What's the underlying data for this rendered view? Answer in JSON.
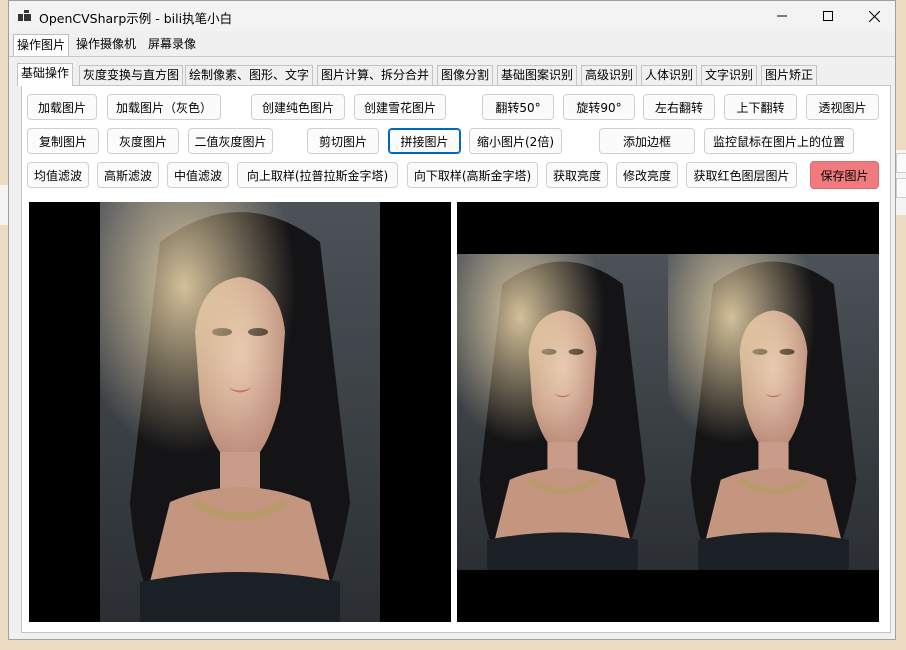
{
  "window": {
    "title": "OpenCVSharp示例 - bili执笔小白"
  },
  "menu": [
    "操作图片",
    "操作摄像机",
    "屏幕录像"
  ],
  "tabs": [
    "基础操作",
    "灰度变换与直方图",
    "绘制像素、图形、文字",
    "图片计算、拆分合并",
    "图像分割",
    "基础图案识别",
    "高级识别",
    "人体识别",
    "文字识别",
    "图片矫正"
  ],
  "buttons": {
    "load_image": "加载图片",
    "load_image_gray": "加载图片（灰色）",
    "create_solid_image": "创建纯色图片",
    "create_snow_image": "创建雪花图片",
    "flip_50": "翻转50°",
    "rotate_90": "旋转90°",
    "flip_horizontal": "左右翻转",
    "flip_vertical": "上下翻转",
    "perspective_image": "透视图片",
    "copy_image": "复制图片",
    "gray_image": "灰度图片",
    "binary_gray_image": "二值灰度图片",
    "crop_image": "剪切图片",
    "concat_image": "拼接图片",
    "shrink_image": "缩小图片(2倍)",
    "add_border": "添加边框",
    "monitor_mouse_position": "监控鼠标在图片上的位置",
    "mean_filter": "均值滤波",
    "gaussian_filter": "高斯滤波",
    "median_filter": "中值滤波",
    "pyr_up": "向上取样(拉普拉斯金字塔)",
    "pyr_down": "向下取样(高斯金字塔)",
    "get_brightness": "获取亮度",
    "modify_brightness": "修改亮度",
    "get_red_layer": "获取红色图层图片",
    "save_image": "保存图片"
  },
  "colors": {
    "save_button_bg": "#f07a7e",
    "focus_border": "#0067c0",
    "image_background": "#000000"
  },
  "icons": {
    "app": "app-grid-icon",
    "minimize": "minimize-icon",
    "maximize": "maximize-icon",
    "close": "close-icon"
  }
}
